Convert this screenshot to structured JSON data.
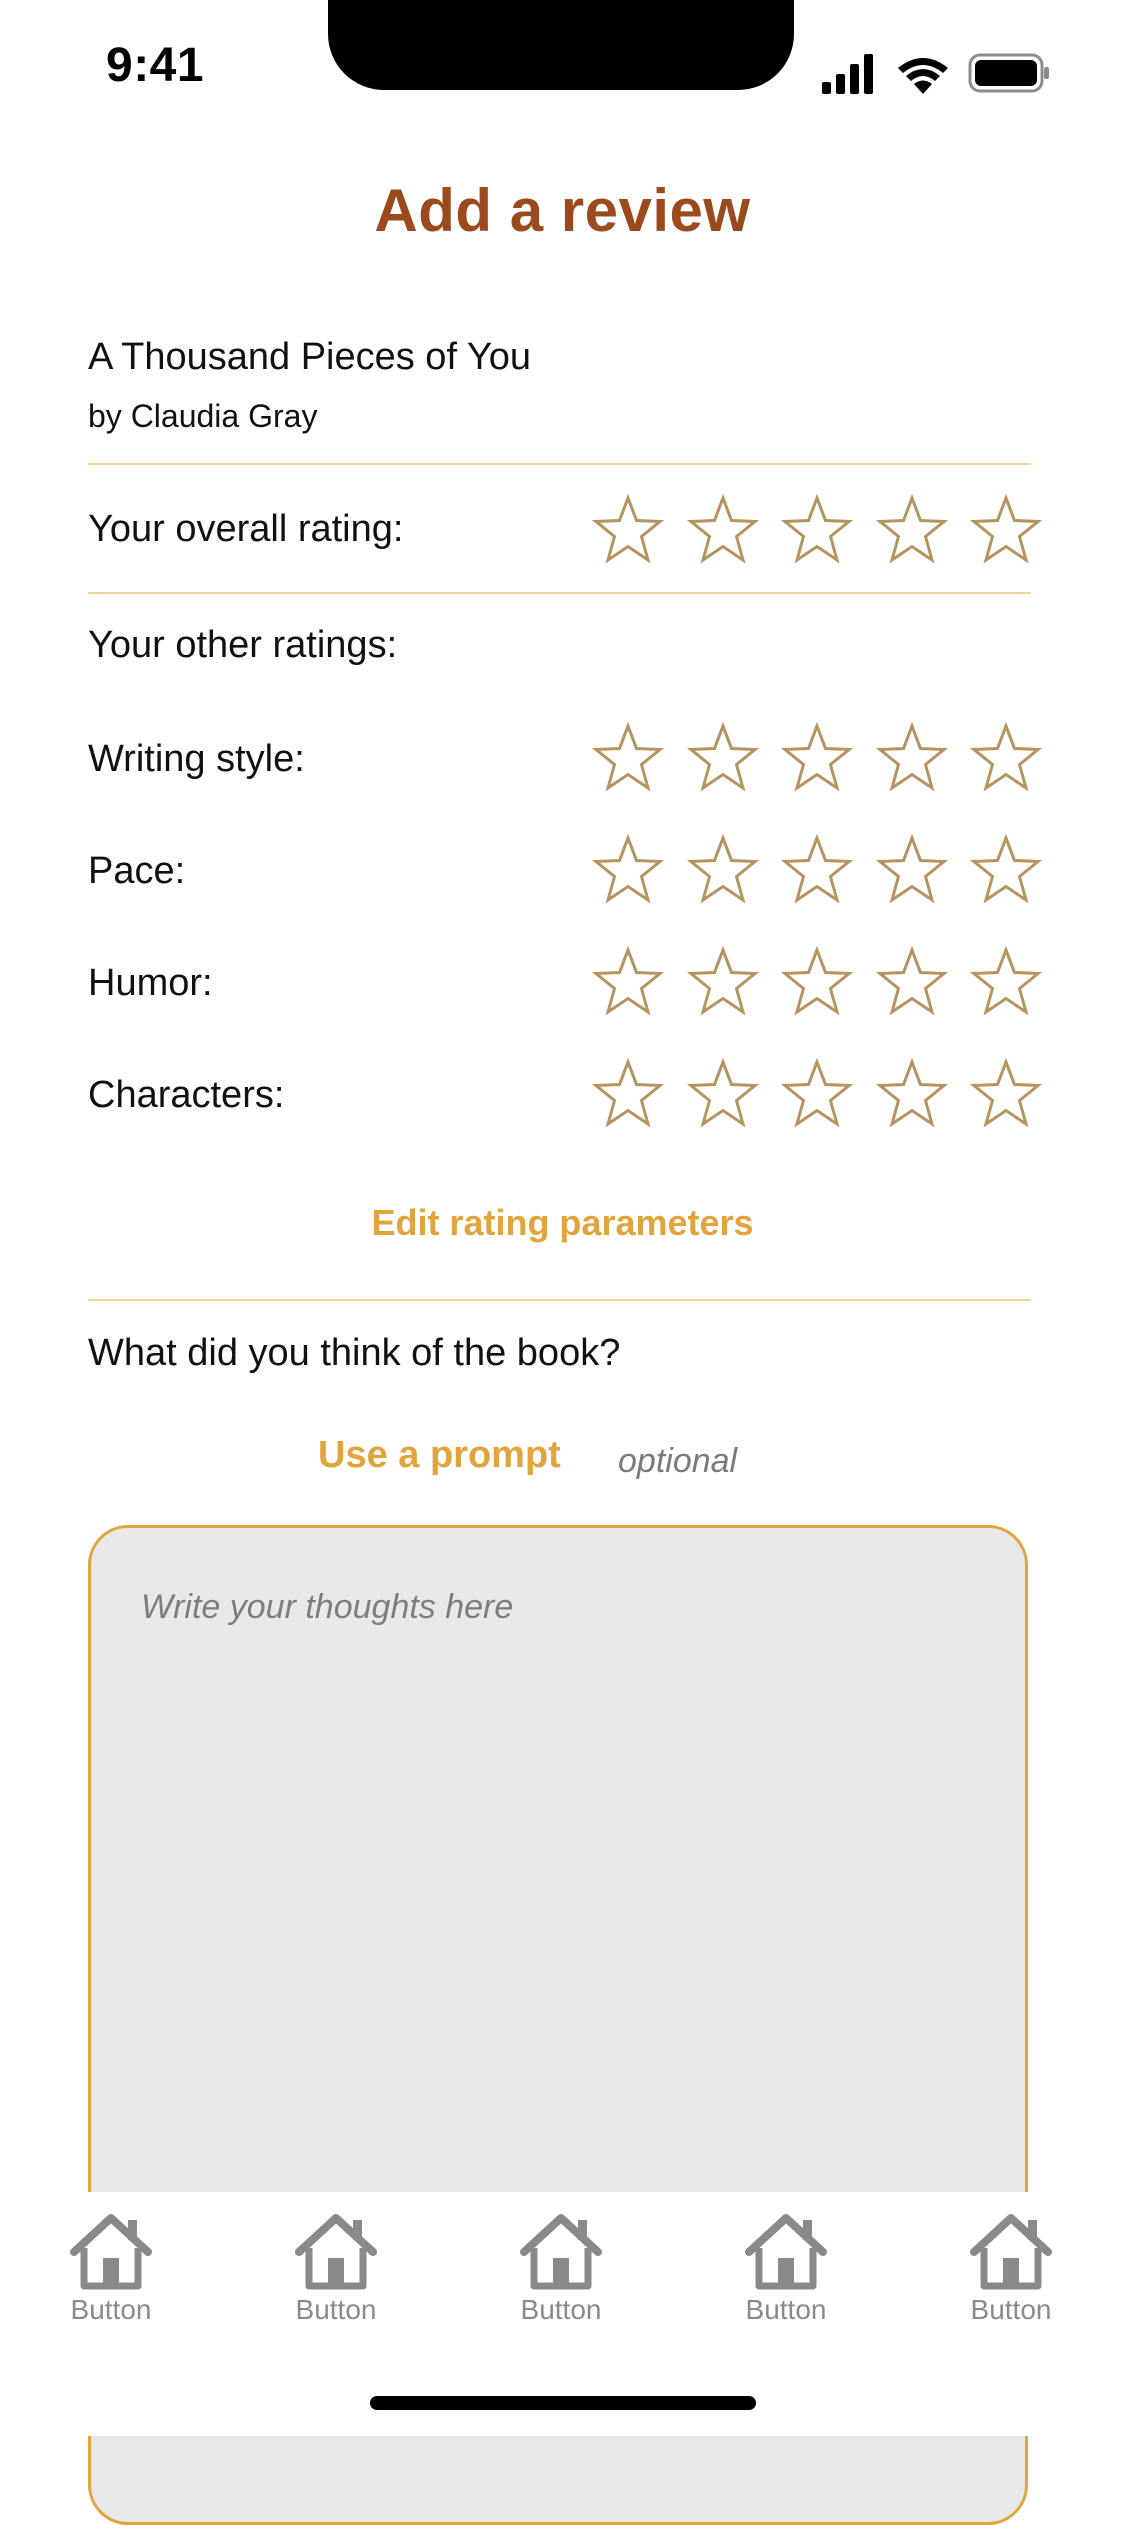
{
  "status_bar": {
    "time": "9:41"
  },
  "header": {
    "title": "Add a review"
  },
  "book": {
    "title": "A Thousand Pieces of You",
    "author": "by Claudia Gray"
  },
  "overall": {
    "label": "Your overall rating:",
    "rating": 0,
    "max": 5
  },
  "other": {
    "heading": "Your other ratings:",
    "items": [
      {
        "label": "Writing style:",
        "rating": 0
      },
      {
        "label": "Pace:",
        "rating": 0
      },
      {
        "label": "Humor:",
        "rating": 0
      },
      {
        "label": "Characters:",
        "rating": 0
      }
    ]
  },
  "edit_link": "Edit rating parameters",
  "review": {
    "question": "What did you think of the book?",
    "prompt_label": "Use a prompt",
    "optional_label": "optional",
    "placeholder": "Write your thoughts here"
  },
  "tabbar": {
    "items": [
      {
        "label": "Button",
        "icon": "home-icon"
      },
      {
        "label": "Button",
        "icon": "home-icon"
      },
      {
        "label": "Button",
        "icon": "home-icon"
      },
      {
        "label": "Button",
        "icon": "home-icon"
      },
      {
        "label": "Button",
        "icon": "home-icon"
      }
    ]
  },
  "colors": {
    "title": "#9b4a1e",
    "accent": "#e2a43c",
    "star_outline": "#b49560",
    "divider": "#f0d49a",
    "textarea_bg": "#e8e8e8",
    "tab_icon": "#8a8a8a"
  }
}
